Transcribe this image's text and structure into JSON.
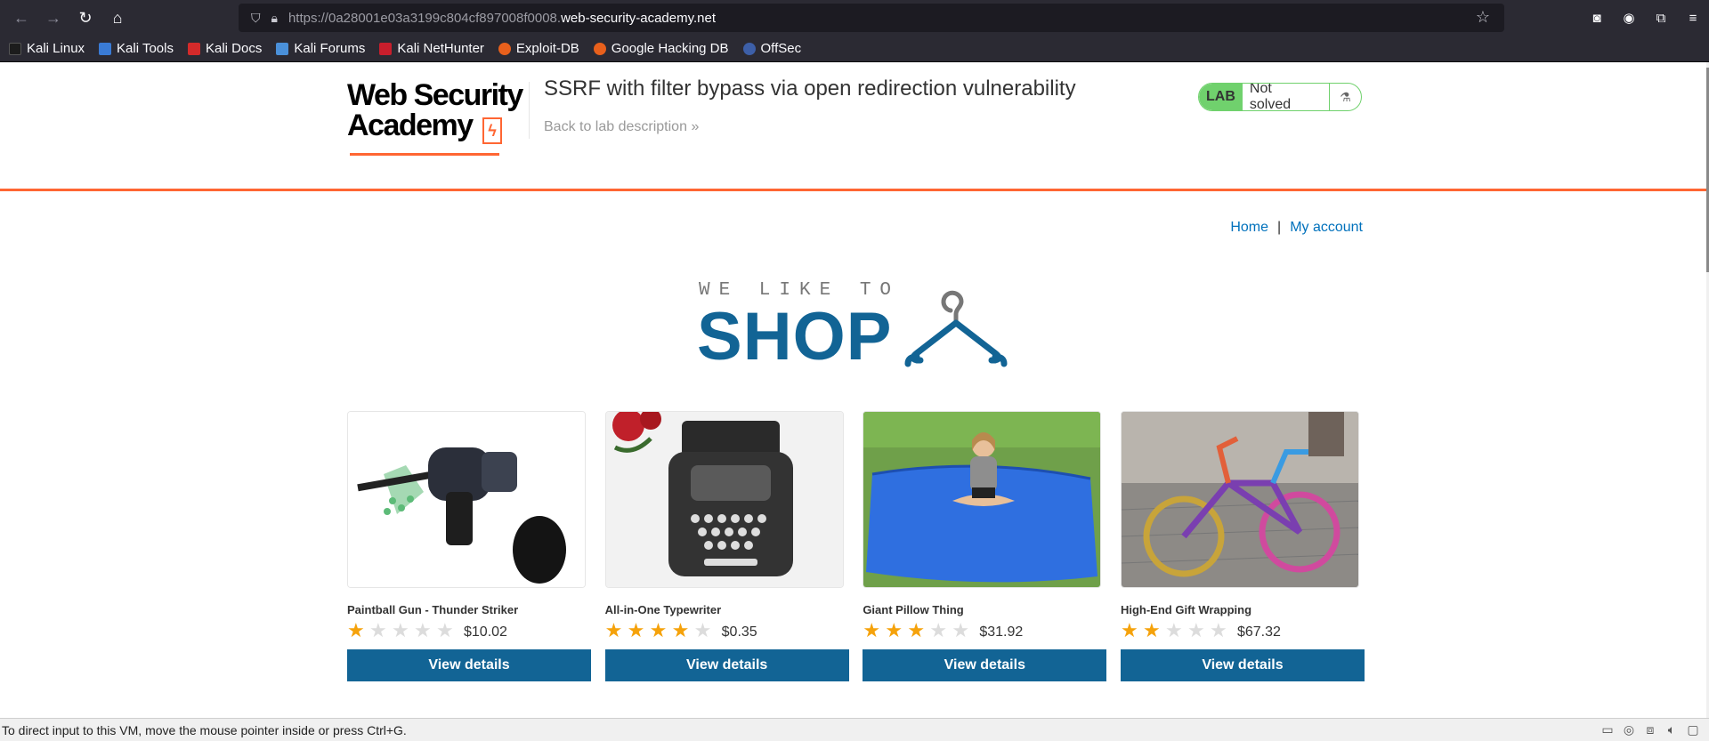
{
  "browser": {
    "url_prefix": "https://0a28001e03a3199c804cf897008f0008.",
    "url_domain": "web-security-academy.net",
    "bookmarks": [
      "Kali Linux",
      "Kali Tools",
      "Kali Docs",
      "Kali Forums",
      "Kali NetHunter",
      "Exploit-DB",
      "Google Hacking DB",
      "OffSec"
    ]
  },
  "header": {
    "logo_line1": "Web Security",
    "logo_line2": "Academy",
    "title": "SSRF with filter bypass via open redirection vulnerability",
    "back_link": "Back to lab description",
    "badge_label": "LAB",
    "badge_status": "Not solved"
  },
  "nav": {
    "home": "Home",
    "separator": "|",
    "account": "My account"
  },
  "banner": {
    "small": "WE LIKE TO",
    "big": "SHOP"
  },
  "products": [
    {
      "name": "Paintball Gun - Thunder Striker",
      "stars": 1,
      "price": "$10.02",
      "button": "View details"
    },
    {
      "name": "All-in-One Typewriter",
      "stars": 4,
      "price": "$0.35",
      "button": "View details"
    },
    {
      "name": "Giant Pillow Thing",
      "stars": 3,
      "price": "$31.92",
      "button": "View details"
    },
    {
      "name": "High-End Gift Wrapping",
      "stars": 2,
      "price": "$67.32",
      "button": "View details"
    }
  ],
  "statusbar": {
    "text": "To direct input to this VM, move the mouse pointer inside or press Ctrl+G."
  },
  "colors": {
    "accent_orange": "#ff6633",
    "primary_blue": "#126495",
    "lab_green": "#70d16d",
    "star_gold": "#f5a20b"
  }
}
